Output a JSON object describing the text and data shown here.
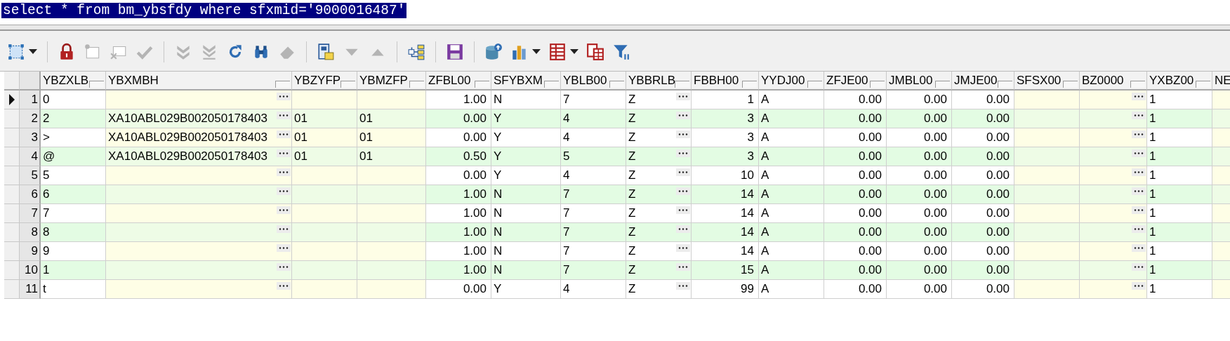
{
  "editor": {
    "text": "select * from bm_ybsfdy where sfxmid='9000016487'",
    "selected": true
  },
  "toolbar": {
    "groups": [
      [
        {
          "kind": "select",
          "disabled": false,
          "dropdown": true
        }
      ],
      [
        {
          "kind": "lock",
          "disabled": false,
          "dropdown": false
        },
        {
          "kind": "new",
          "disabled": true,
          "dropdown": false
        },
        {
          "kind": "delete",
          "disabled": true,
          "dropdown": false
        },
        {
          "kind": "confirm",
          "disabled": true,
          "dropdown": false
        }
      ],
      [
        {
          "kind": "next",
          "disabled": true,
          "dropdown": false
        },
        {
          "kind": "last",
          "disabled": true,
          "dropdown": false
        },
        {
          "kind": "refresh",
          "disabled": false,
          "dropdown": false
        },
        {
          "kind": "find",
          "disabled": false,
          "dropdown": false
        },
        {
          "kind": "clear",
          "disabled": true,
          "dropdown": false
        }
      ],
      [
        {
          "kind": "report",
          "disabled": false,
          "dropdown": false
        },
        {
          "kind": "down",
          "disabled": true,
          "dropdown": false
        },
        {
          "kind": "up",
          "disabled": true,
          "dropdown": false
        }
      ],
      [
        {
          "kind": "tree",
          "disabled": false,
          "dropdown": false
        }
      ],
      [
        {
          "kind": "save",
          "disabled": false,
          "dropdown": false
        }
      ],
      [
        {
          "kind": "import",
          "disabled": false,
          "dropdown": false
        },
        {
          "kind": "chart",
          "disabled": false,
          "dropdown": true
        },
        {
          "kind": "grid",
          "disabled": false,
          "dropdown": true
        },
        {
          "kind": "columns",
          "disabled": false,
          "dropdown": false
        },
        {
          "kind": "filter",
          "disabled": false,
          "dropdown": false
        }
      ]
    ]
  },
  "table": {
    "columns": [
      {
        "label": "YBZXLB",
        "kind": "text",
        "lookup": false,
        "picker": false
      },
      {
        "label": "YBXMBH",
        "kind": "text",
        "lookup": true,
        "picker": true
      },
      {
        "label": "YBZYFP",
        "kind": "text",
        "lookup": true,
        "picker": false
      },
      {
        "label": "YBMZFP",
        "kind": "text",
        "lookup": true,
        "picker": false
      },
      {
        "label": "ZFBL00",
        "kind": "number",
        "lookup": false,
        "picker": false
      },
      {
        "label": "SFYBXM",
        "kind": "text",
        "lookup": false,
        "picker": false
      },
      {
        "label": "YBLB00",
        "kind": "text",
        "lookup": false,
        "picker": false
      },
      {
        "label": "YBBRLB",
        "kind": "text",
        "lookup": false,
        "picker": true
      },
      {
        "label": "FBBH00",
        "kind": "number",
        "lookup": false,
        "picker": false
      },
      {
        "label": "YYDJ00",
        "kind": "text",
        "lookup": false,
        "picker": false
      },
      {
        "label": "ZFJE00",
        "kind": "number",
        "lookup": false,
        "picker": false
      },
      {
        "label": "JMBL00",
        "kind": "number",
        "lookup": false,
        "picker": false
      },
      {
        "label": "JMJE00",
        "kind": "number",
        "lookup": false,
        "picker": false
      },
      {
        "label": "SFSX00",
        "kind": "text",
        "lookup": true,
        "picker": false
      },
      {
        "label": "BZ0000",
        "kind": "text",
        "lookup": true,
        "picker": true
      },
      {
        "label": "YXBZ00",
        "kind": "text",
        "lookup": false,
        "picker": false
      },
      {
        "label": "NE",
        "kind": "text",
        "lookup": true,
        "picker": false
      }
    ],
    "rows": [
      {
        "number": "1",
        "selected": true,
        "cells": [
          "0",
          null,
          null,
          null,
          "1.00",
          "N",
          "7",
          "Z",
          "1",
          "A",
          "0.00",
          "0.00",
          "0.00",
          null,
          null,
          "1",
          null
        ]
      },
      {
        "number": "2",
        "selected": false,
        "cells": [
          "2",
          "XA10ABL029B002050178403",
          "01",
          "01",
          "0.00",
          "Y",
          "4",
          "Z",
          "3",
          "A",
          "0.00",
          "0.00",
          "0.00",
          null,
          null,
          "1",
          null
        ]
      },
      {
        "number": "3",
        "selected": false,
        "cells": [
          ">",
          "XA10ABL029B002050178403",
          "01",
          "01",
          "0.00",
          "Y",
          "4",
          "Z",
          "3",
          "A",
          "0.00",
          "0.00",
          "0.00",
          null,
          null,
          "1",
          null
        ]
      },
      {
        "number": "4",
        "selected": false,
        "cells": [
          "@",
          "XA10ABL029B002050178403",
          "01",
          "01",
          "0.50",
          "Y",
          "5",
          "Z",
          "3",
          "A",
          "0.00",
          "0.00",
          "0.00",
          null,
          null,
          "1",
          null
        ]
      },
      {
        "number": "5",
        "selected": false,
        "cells": [
          "5",
          null,
          null,
          null,
          "0.00",
          "Y",
          "4",
          "Z",
          "10",
          "A",
          "0.00",
          "0.00",
          "0.00",
          null,
          null,
          "1",
          null
        ]
      },
      {
        "number": "6",
        "selected": false,
        "cells": [
          "6",
          null,
          null,
          null,
          "1.00",
          "N",
          "7",
          "Z",
          "14",
          "A",
          "0.00",
          "0.00",
          "0.00",
          null,
          null,
          "1",
          null
        ]
      },
      {
        "number": "7",
        "selected": false,
        "cells": [
          "7",
          null,
          null,
          null,
          "1.00",
          "N",
          "7",
          "Z",
          "14",
          "A",
          "0.00",
          "0.00",
          "0.00",
          null,
          null,
          "1",
          null
        ]
      },
      {
        "number": "8",
        "selected": false,
        "cells": [
          "8",
          null,
          null,
          null,
          "1.00",
          "N",
          "7",
          "Z",
          "14",
          "A",
          "0.00",
          "0.00",
          "0.00",
          null,
          null,
          "1",
          null
        ]
      },
      {
        "number": "9",
        "selected": false,
        "cells": [
          "9",
          null,
          null,
          null,
          "1.00",
          "N",
          "7",
          "Z",
          "14",
          "A",
          "0.00",
          "0.00",
          "0.00",
          null,
          null,
          "1",
          null
        ]
      },
      {
        "number": "10",
        "selected": false,
        "cells": [
          "1",
          null,
          null,
          null,
          "1.00",
          "N",
          "7",
          "Z",
          "15",
          "A",
          "0.00",
          "0.00",
          "0.00",
          null,
          null,
          "1",
          null
        ]
      },
      {
        "number": "11",
        "selected": false,
        "cells": [
          "t",
          null,
          null,
          null,
          "0.00",
          "Y",
          "4",
          "Z",
          "99",
          "A",
          "0.00",
          "0.00",
          "0.00",
          null,
          null,
          "1",
          null
        ]
      }
    ]
  }
}
